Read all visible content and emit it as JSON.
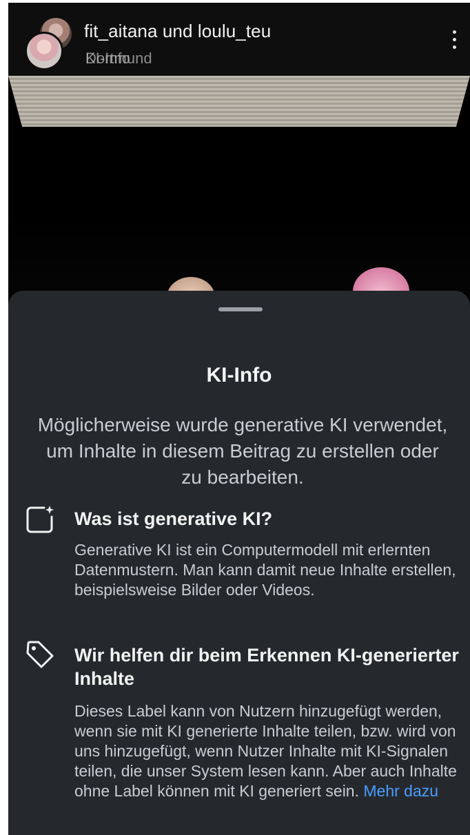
{
  "header": {
    "title": "fit_aitana und loulu_teu",
    "sub_line_1": "KI-Info",
    "sub_line_2": "Dortmund"
  },
  "sheet": {
    "title": "KI-Info",
    "intro": "Möglicherweise wurde generative KI verwendet, um Inhalte in diesem Beitrag zu erstellen oder zu bearbeiten.",
    "sections": [
      {
        "icon": "ai-sparkle-frame-icon",
        "heading": "Was ist generative KI?",
        "body": "Generative KI ist ein Computermodell mit erlernten Datenmustern. Man kann damit neue Inhalte erstellen, beispielsweise Bilder oder Videos."
      },
      {
        "icon": "tag-icon",
        "heading": "Wir helfen dir beim Erkennen KI-generierter Inhalte",
        "body": "Dieses Label kann von Nutzern hinzugefügt werden, wenn sie mit KI generierte Inhalte teilen, bzw. wird von uns hinzugefügt, wenn Nutzer Inhalte mit KI-Signalen teilen, die unser System lesen kann. Aber auch Inhalte ohne Label können mit KI generiert sein.",
        "link": "Mehr dazu"
      }
    ]
  },
  "colors": {
    "sheet_bg": "#25292e",
    "link": "#4a9dff"
  }
}
